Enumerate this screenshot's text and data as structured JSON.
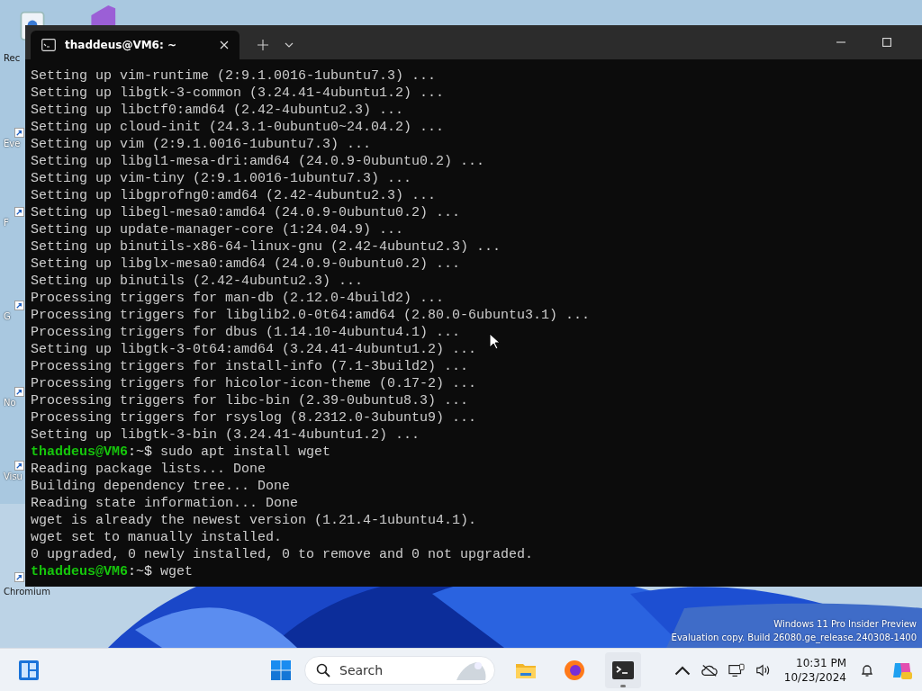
{
  "desktop": {
    "icons": [
      {
        "label": "Rec",
        "kind": "bin"
      },
      {
        "label": "Eve",
        "kind": "shortcut"
      },
      {
        "label": "F",
        "kind": "shortcut"
      },
      {
        "label": "G",
        "kind": "shortcut"
      },
      {
        "label": "No",
        "kind": "shortcut"
      },
      {
        "label": "Visu",
        "kind": "shortcut"
      },
      {
        "label": "Chromium",
        "kind": "shortcut"
      }
    ],
    "watermark": [
      "Windows 11 Pro Insider Preview",
      "Evaluation copy. Build 26080.ge_release.240308-1400"
    ]
  },
  "terminal": {
    "tab": {
      "title": "thaddeus@VM6: ~",
      "selected": true
    },
    "lines": [
      {
        "kind": "output",
        "text": "Setting up vim-runtime (2:9.1.0016-1ubuntu7.3) ..."
      },
      {
        "kind": "output",
        "text": "Setting up libgtk-3-common (3.24.41-4ubuntu1.2) ..."
      },
      {
        "kind": "output",
        "text": "Setting up libctf0:amd64 (2.42-4ubuntu2.3) ..."
      },
      {
        "kind": "output",
        "text": "Setting up cloud-init (24.3.1-0ubuntu0~24.04.2) ..."
      },
      {
        "kind": "output",
        "text": "Setting up vim (2:9.1.0016-1ubuntu7.3) ..."
      },
      {
        "kind": "output",
        "text": "Setting up libgl1-mesa-dri:amd64 (24.0.9-0ubuntu0.2) ..."
      },
      {
        "kind": "output",
        "text": "Setting up vim-tiny (2:9.1.0016-1ubuntu7.3) ..."
      },
      {
        "kind": "output",
        "text": "Setting up libgprofng0:amd64 (2.42-4ubuntu2.3) ..."
      },
      {
        "kind": "output",
        "text": "Setting up libegl-mesa0:amd64 (24.0.9-0ubuntu0.2) ..."
      },
      {
        "kind": "output",
        "text": "Setting up update-manager-core (1:24.04.9) ..."
      },
      {
        "kind": "output",
        "text": "Setting up binutils-x86-64-linux-gnu (2.42-4ubuntu2.3) ..."
      },
      {
        "kind": "output",
        "text": "Setting up libglx-mesa0:amd64 (24.0.9-0ubuntu0.2) ..."
      },
      {
        "kind": "output",
        "text": "Setting up binutils (2.42-4ubuntu2.3) ..."
      },
      {
        "kind": "output",
        "text": "Processing triggers for man-db (2.12.0-4build2) ..."
      },
      {
        "kind": "output",
        "text": "Processing triggers for libglib2.0-0t64:amd64 (2.80.0-6ubuntu3.1) ..."
      },
      {
        "kind": "output",
        "text": "Processing triggers for dbus (1.14.10-4ubuntu4.1) ..."
      },
      {
        "kind": "output",
        "text": "Setting up libgtk-3-0t64:amd64 (3.24.41-4ubuntu1.2) ..."
      },
      {
        "kind": "output",
        "text": "Processing triggers for install-info (7.1-3build2) ..."
      },
      {
        "kind": "output",
        "text": "Processing triggers for hicolor-icon-theme (0.17-2) ..."
      },
      {
        "kind": "output",
        "text": "Processing triggers for libc-bin (2.39-0ubuntu8.3) ..."
      },
      {
        "kind": "output",
        "text": "Processing triggers for rsyslog (8.2312.0-3ubuntu9) ..."
      },
      {
        "kind": "output",
        "text": "Setting up libgtk-3-bin (3.24.41-4ubuntu1.2) ..."
      },
      {
        "kind": "prompt",
        "user": "thaddeus@VM6",
        "path": ":~$",
        "text": "sudo apt install wget"
      },
      {
        "kind": "output",
        "text": "Reading package lists... Done"
      },
      {
        "kind": "output",
        "text": "Building dependency tree... Done"
      },
      {
        "kind": "output",
        "text": "Reading state information... Done"
      },
      {
        "kind": "output",
        "text": "wget is already the newest version (1.21.4-1ubuntu4.1)."
      },
      {
        "kind": "output",
        "text": "wget set to manually installed."
      },
      {
        "kind": "output",
        "text": "0 upgraded, 0 newly installed, 0 to remove and 0 not upgraded."
      },
      {
        "kind": "prompt",
        "user": "thaddeus@VM6",
        "path": ":~$",
        "text": "wget"
      }
    ]
  },
  "taskbar": {
    "search": {
      "placeholder": "Search"
    },
    "apps": [
      {
        "kind": "explorer",
        "selected": false
      },
      {
        "kind": "firefox",
        "selected": false
      },
      {
        "kind": "terminal",
        "selected": true
      }
    ],
    "clock": {
      "time": "10:31 PM",
      "date": "10/23/2024"
    }
  }
}
